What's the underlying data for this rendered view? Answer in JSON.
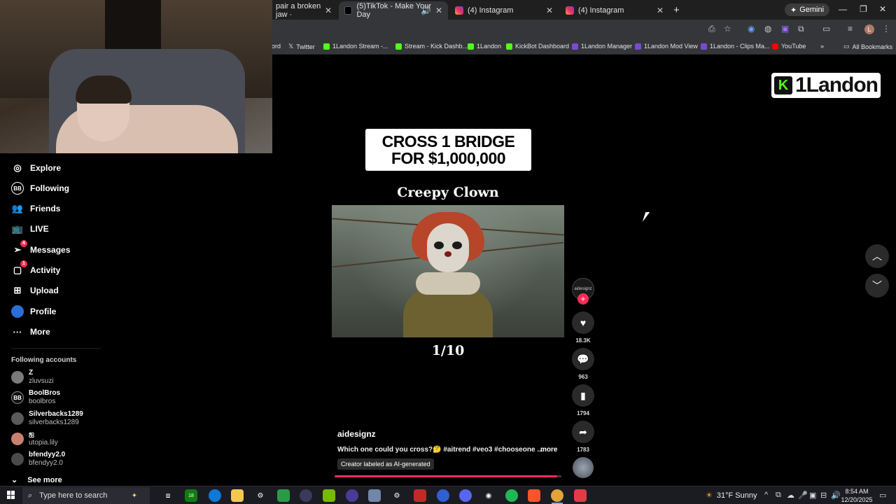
{
  "browser": {
    "tabs": [
      {
        "label": "pair a broken jaw ·"
      },
      {
        "label": "(5)TikTok - Make Your Day"
      },
      {
        "label": "(4) Instagram"
      },
      {
        "label": "(4) Instagram"
      }
    ],
    "gemini_label": "Gemini",
    "bookmarks": [
      {
        "label": "ord"
      },
      {
        "label": "Twitter"
      },
      {
        "label": "1Landon Stream -..."
      },
      {
        "label": "Stream - Kick Dashb..."
      },
      {
        "label": "1Landon"
      },
      {
        "label": "KickBot Dashboard"
      },
      {
        "label": "1Landon Manager"
      },
      {
        "label": "1Landon Mod View"
      },
      {
        "label": "1Landon - Clips Ma..."
      },
      {
        "label": "YouTube"
      }
    ],
    "all_bookmarks_label": "All Bookmarks",
    "profile_initial": "L"
  },
  "overlay": {
    "kick_logo_letter": "K",
    "streamer_name": "1Landon"
  },
  "sidebar": {
    "nav": [
      {
        "label": "Explore",
        "icon": "compass-icon"
      },
      {
        "label": "Following",
        "icon": "following-icon"
      },
      {
        "label": "Friends",
        "icon": "friends-icon"
      },
      {
        "label": "LIVE",
        "icon": "live-icon"
      },
      {
        "label": "Messages",
        "icon": "messages-icon",
        "badge": "4"
      },
      {
        "label": "Activity",
        "icon": "activity-icon",
        "badge": "1"
      },
      {
        "label": "Upload",
        "icon": "upload-icon"
      },
      {
        "label": "Profile",
        "icon": "profile-avatar"
      },
      {
        "label": "More",
        "icon": "more-icon"
      }
    ],
    "following_heading": "Following accounts",
    "accounts": [
      {
        "name": "Z",
        "handle": "zluvsuzi"
      },
      {
        "name": "BoolBros",
        "handle": "boolbros"
      },
      {
        "name": "Silverbacks1289",
        "handle": "silverbacks1289"
      },
      {
        "name": "ஐ",
        "handle": "utopia.lily"
      },
      {
        "name": "bfendyy2.0",
        "handle": "bfendyy2.0"
      }
    ],
    "see_more": "See more"
  },
  "video": {
    "banner_line1": "CROSS 1 BRIDGE",
    "banner_line2": "FOR $1,000,000",
    "title": "Creepy Clown",
    "counter": "1/10",
    "author": "aidesignz",
    "caption": "Which one could you cross?🤔 #aitrend #veo3 #chooseone ...",
    "more": "more",
    "ai_label": "Creator labeled as AI-generated",
    "progress": 0.98,
    "avatar_text": "aidesignz"
  },
  "actions": {
    "likes": "18.3K",
    "comments": "963",
    "saves": "1794",
    "shares": "1783"
  },
  "taskbar": {
    "search_placeholder": "Type here to search",
    "weather": "31°F  Sunny",
    "time": "8:54 AM",
    "date": "12/20/2025",
    "xbox_badge": "18"
  },
  "colors": {
    "tiktok_accent": "#fe2c55",
    "kick_green": "#53fc18",
    "chrome_toolbar": "#35363a"
  }
}
